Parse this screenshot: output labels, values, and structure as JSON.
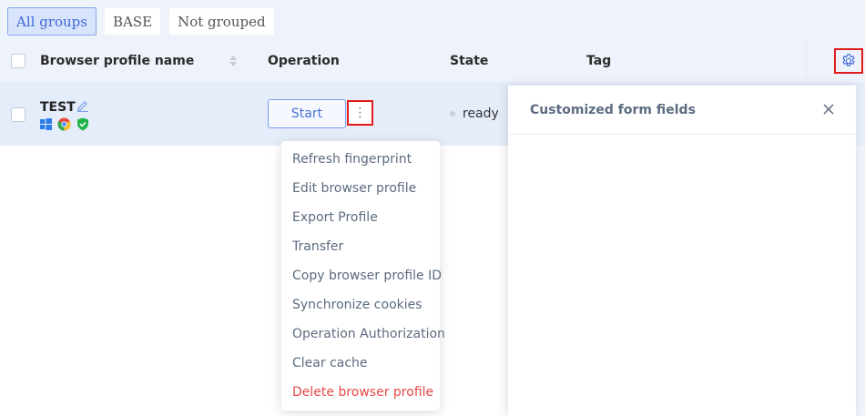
{
  "groups": [
    {
      "label": "All groups",
      "active": true
    },
    {
      "label": "BASE",
      "active": false
    },
    {
      "label": "Not grouped",
      "active": false
    }
  ],
  "table": {
    "headers": {
      "name": "Browser profile name",
      "operation": "Operation",
      "state": "State",
      "tag": "Tag"
    },
    "rows": [
      {
        "name": "TEST",
        "icons": [
          "windows-icon",
          "chrome-icon",
          "shield-check-icon"
        ],
        "start_label": "Start",
        "more_label": "⋮",
        "state": "ready"
      }
    ]
  },
  "dropdown": {
    "items": [
      "Refresh fingerprint",
      "Edit browser profile",
      "Export Profile",
      "Transfer",
      "Copy browser profile ID",
      "Synchronize cookies",
      "Operation Authorization",
      "Clear cache",
      "Delete browser profile"
    ],
    "danger_item": "Delete browser profile"
  },
  "panel": {
    "title": "Customized form fields",
    "close_label": "close"
  },
  "colors": {
    "accent": "#3f6ad8",
    "highlight_box": "#e01b1b",
    "danger": "#e84848"
  }
}
